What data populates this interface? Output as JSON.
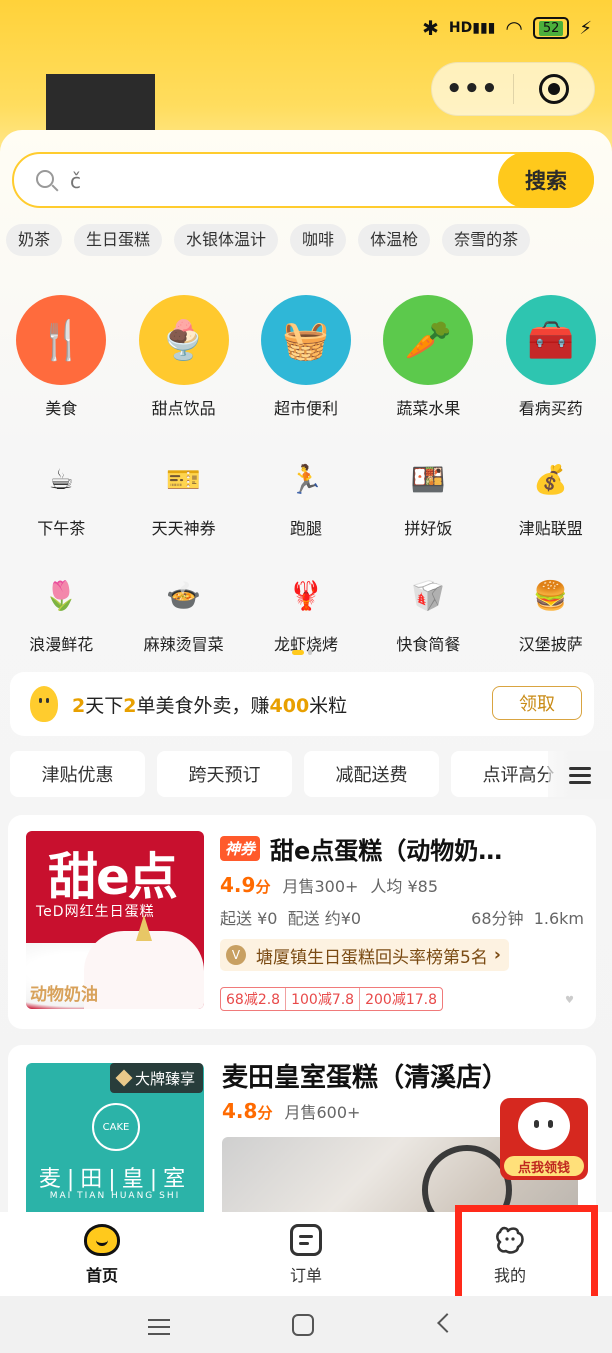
{
  "status_bar": {
    "battery": "52",
    "hd": "HD"
  },
  "search": {
    "placeholder": "č",
    "button": "搜索"
  },
  "hot_tags": [
    "奶茶",
    "生日蛋糕",
    "水银体温计",
    "咖啡",
    "体温枪",
    "奈雪的茶"
  ],
  "categories_big": [
    {
      "label": "美食",
      "icon": "utensils-icon",
      "bg": "#ff6b3d"
    },
    {
      "label": "甜点饮品",
      "icon": "dessert-icon",
      "bg": "#ffc92e"
    },
    {
      "label": "超市便利",
      "icon": "basket-icon",
      "bg": "#2fb7d7"
    },
    {
      "label": "蔬菜水果",
      "icon": "carrot-icon",
      "bg": "#5cc94c"
    },
    {
      "label": "看病买药",
      "icon": "medicine-box-icon",
      "bg": "#2ec5b0"
    }
  ],
  "categories_row2": [
    {
      "label": "下午茶",
      "icon": "teacup-icon"
    },
    {
      "label": "天天神券",
      "icon": "coupon-icon"
    },
    {
      "label": "跑腿",
      "icon": "runner-icon"
    },
    {
      "label": "拼好饭",
      "icon": "bowl-icon"
    },
    {
      "label": "津贴联盟",
      "icon": "money-bag-icon"
    }
  ],
  "categories_row3": [
    {
      "label": "浪漫鲜花",
      "icon": "flower-icon"
    },
    {
      "label": "麻辣烫冒菜",
      "icon": "hotpot-icon"
    },
    {
      "label": "龙虾烧烤",
      "icon": "lobster-icon"
    },
    {
      "label": "快食简餐",
      "icon": "fastfood-icon"
    },
    {
      "label": "汉堡披萨",
      "icon": "burger-icon"
    }
  ],
  "promo": {
    "p1": "2",
    "p2": "天下",
    "p3": "2",
    "p4": "单美食外卖，赚",
    "p5": "400",
    "p6": "米粒",
    "button": "领取"
  },
  "filters": [
    "津贴优惠",
    "跨天预订",
    "减配送费",
    "点评高分"
  ],
  "shop1": {
    "coupon_tag": "神券",
    "name": "甜e点蛋糕（动物奶…",
    "rating": "4.9",
    "rating_unit": "分",
    "monthly_sales": "月售300+",
    "avg_price": "人均 ¥85",
    "min_order": "起送 ¥0",
    "delivery_fee": "配送 约¥0",
    "eta": "68分钟",
    "distance": "1.6km",
    "rank": "塘厦镇生日蛋糕回头率榜第5名",
    "discounts": [
      "68减2.8",
      "100减7.8",
      "200减17.8"
    ],
    "img_title": "甜e点",
    "img_sub": "TeD网红生日蛋糕",
    "img_foot": "动物奶油"
  },
  "shop2": {
    "badge": "大牌臻享",
    "name": "麦田皇室蛋糕（清溪店）",
    "rating": "4.8",
    "rating_unit": "分",
    "monthly_sales": "月售600+",
    "img_title": "麦|田|皇|室",
    "img_pinyin": "MAI  TIAN  HUANG  SHI",
    "img_logo": "CAKE"
  },
  "float_reward": {
    "label": "点我领钱"
  },
  "tabs": [
    {
      "label": "首页",
      "icon": "home-mascot-icon",
      "active": true
    },
    {
      "label": "订单",
      "icon": "order-icon",
      "active": false
    },
    {
      "label": "我的",
      "icon": "profile-mascot-icon",
      "active": false
    }
  ]
}
